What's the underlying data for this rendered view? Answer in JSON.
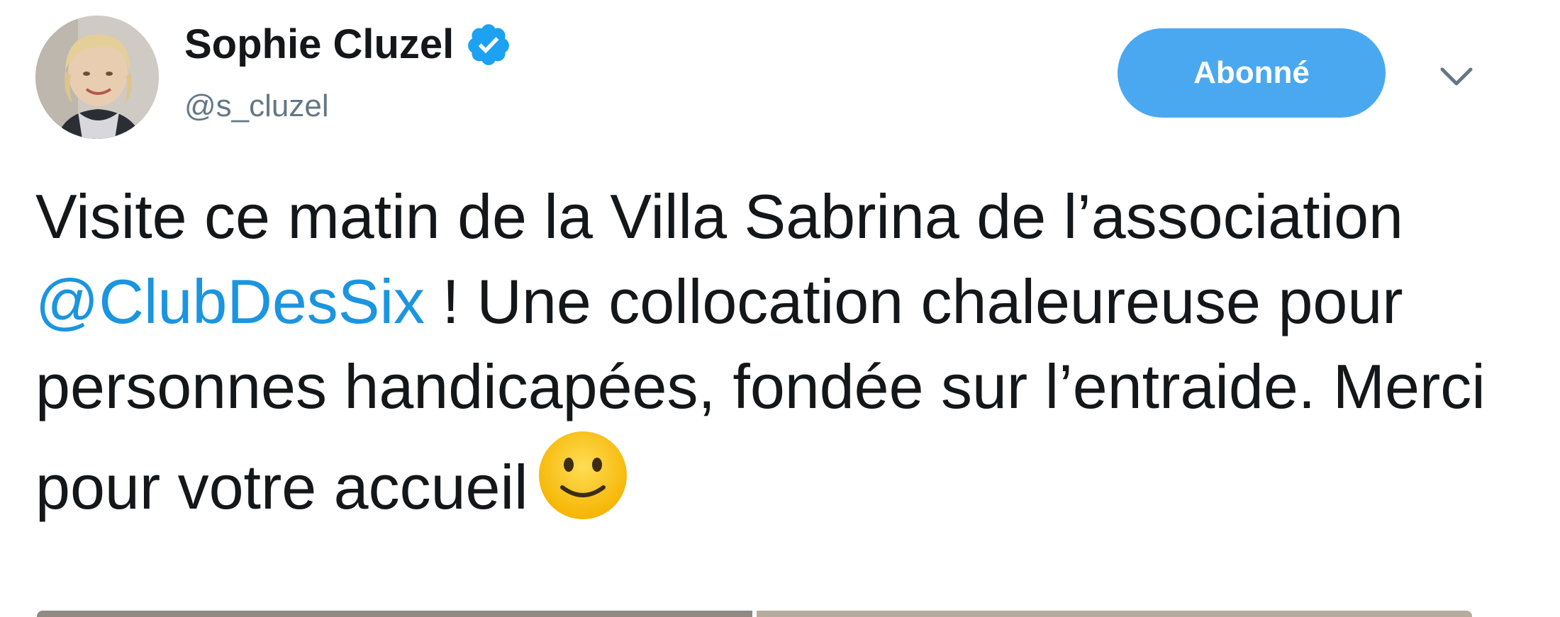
{
  "tweet": {
    "author": {
      "display_name": "Sophie Cluzel",
      "handle": "@s_cluzel",
      "verified": true,
      "avatar_icon": "avatar-photo"
    },
    "follow_button_label": "Abonné",
    "menu_icon": "chevron-down-icon",
    "text": {
      "part1": "Visite ce matin de la Villa Sabrina de l’association ",
      "mention": "@ClubDesSix",
      "part2": " ! Une collocation chaleureuse pour personnes handicapées, fondée sur l’entraide. Merci pour votre accueil",
      "emoji": "slightly-smiling-face-icon"
    }
  },
  "colors": {
    "accent": "#1b95e0",
    "follow_button_bg": "#4aa8f0",
    "handle_gray": "#657786",
    "text": "#14171a"
  }
}
